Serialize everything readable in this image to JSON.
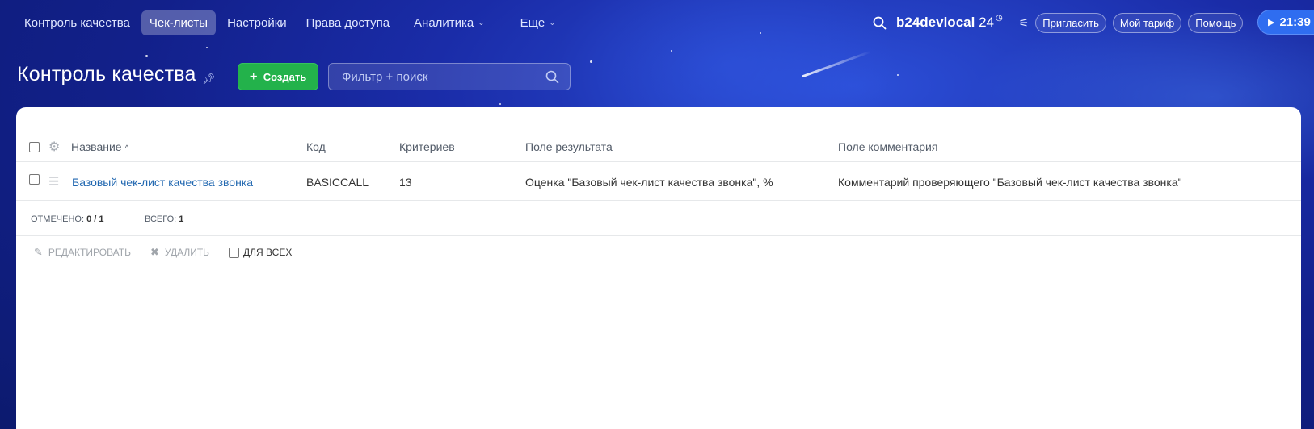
{
  "nav": {
    "items": [
      {
        "label": "Контроль качества",
        "active": false
      },
      {
        "label": "Чек-листы",
        "active": true
      },
      {
        "label": "Настройки",
        "active": false
      },
      {
        "label": "Права доступа",
        "active": false
      },
      {
        "label": "Аналитика",
        "active": false,
        "dropdown": true
      },
      {
        "label": "Еще",
        "active": false,
        "dropdown": true
      }
    ]
  },
  "header": {
    "portal_name": "b24devlocal",
    "portal_suffix": "24",
    "invite_label": "Пригласить",
    "tariff_label": "Мой тариф",
    "help_label": "Помощь",
    "timer": "21:39"
  },
  "page": {
    "title": "Контроль качества",
    "create_label": "Создать",
    "search_placeholder": "Фильтр + поиск"
  },
  "table": {
    "columns": [
      "Название",
      "Код",
      "Критериев",
      "Поле результата",
      "Поле комментария"
    ],
    "rows": [
      {
        "name": "Базовый чек-лист качества звонка",
        "code": "BASICCALL",
        "criteria": "13",
        "result_field": "Оценка \"Базовый чек-лист качества звонка\", %",
        "comment_field": "Комментарий проверяющего \"Базовый чек-лист качества звонка\""
      }
    ]
  },
  "footer": {
    "selected_label": "ОТМЕЧЕНО:",
    "selected_value": "0 / 1",
    "total_label": "ВСЕГО:",
    "total_value": "1"
  },
  "actions": {
    "edit_label": "РЕДАКТИРОВАТЬ",
    "delete_label": "УДАЛИТЬ",
    "for_all_label": "ДЛЯ ВСЕХ"
  },
  "colors": {
    "accent_green": "#23b24b",
    "link_blue": "#2067b0",
    "timer_blue": "#2f6df0"
  }
}
